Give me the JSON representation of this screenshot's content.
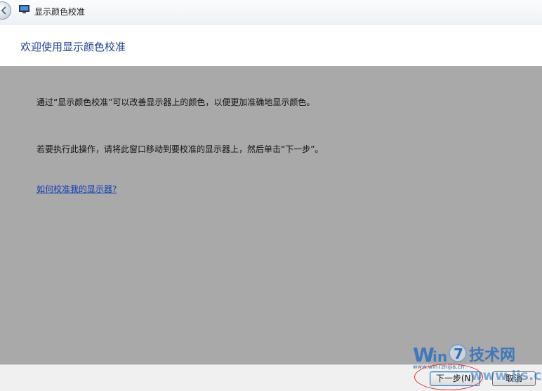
{
  "window": {
    "title": "显示颜色校准"
  },
  "header": {
    "heading": "欢迎使用显示颜色校准"
  },
  "content": {
    "paragraph_1": "通过“显示颜色校准”可以改善显示器上的颜色，以便更加准确地显示颜色。",
    "paragraph_2": "若要执行此操作，请将此窗口移动到要校准的显示器上，然后单击“下一步”。",
    "help_link": "如何校准我的显示器?"
  },
  "footer": {
    "next_label": "下一步(N)",
    "cancel_label": "取消"
  },
  "watermark": {
    "brand_w": "W",
    "brand_in": "in",
    "brand_7": "7",
    "brand_cn": "技术网",
    "url_left": "www.win7zhijia.cn",
    "url_right": "www.ljs.cn"
  },
  "colors": {
    "heading": "#1c3f94",
    "content_bg": "#a9a9a9",
    "link": "#0b3fb5",
    "watermark_blue": "#2a6fc0",
    "annotation_red": "#e03030"
  }
}
